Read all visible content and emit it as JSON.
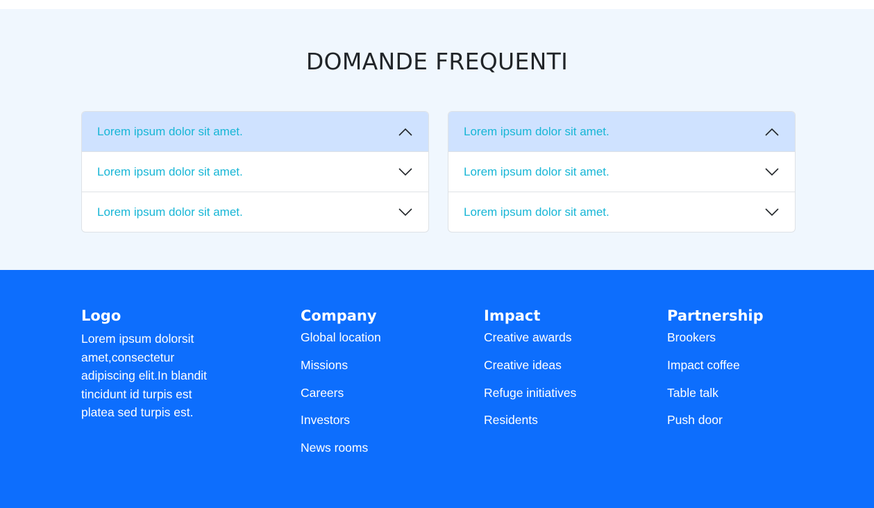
{
  "faq": {
    "title": "DOMANDE FREQUENTI",
    "left": [
      {
        "label": "Lorem ipsum dolor sit amet.",
        "expanded": true
      },
      {
        "label": "Lorem ipsum dolor sit amet.",
        "expanded": false
      },
      {
        "label": "Lorem ipsum dolor sit amet.",
        "expanded": false
      }
    ],
    "right": [
      {
        "label": "Lorem ipsum dolor sit amet.",
        "expanded": true
      },
      {
        "label": "Lorem ipsum dolor sit amet.",
        "expanded": false
      },
      {
        "label": "Lorem ipsum dolor sit amet.",
        "expanded": false
      }
    ]
  },
  "footer": {
    "logo": {
      "heading": "Logo",
      "text": "Lorem ipsum dolorsit amet,consectetur adipiscing elit.In blandit tincidunt id turpis est platea sed turpis est."
    },
    "company": {
      "heading": "Company",
      "links": [
        "Global location",
        "Missions",
        "Careers",
        "Investors",
        "News rooms"
      ]
    },
    "impact": {
      "heading": "Impact",
      "links": [
        "Creative awards",
        "Creative ideas",
        "Refuge initiatives",
        "Residents"
      ]
    },
    "partnership": {
      "heading": "Partnership",
      "links": [
        "Brookers",
        "Impact coffee",
        "Table talk",
        "Push door"
      ]
    }
  },
  "colors": {
    "faq_background": "#f0f7fe",
    "accordion_open": "#cfe2ff",
    "accordion_text": "#17b6d6",
    "footer_background": "#0d6efd"
  },
  "icons": {
    "expanded": "chevron-up-icon",
    "collapsed": "chevron-down-icon"
  }
}
